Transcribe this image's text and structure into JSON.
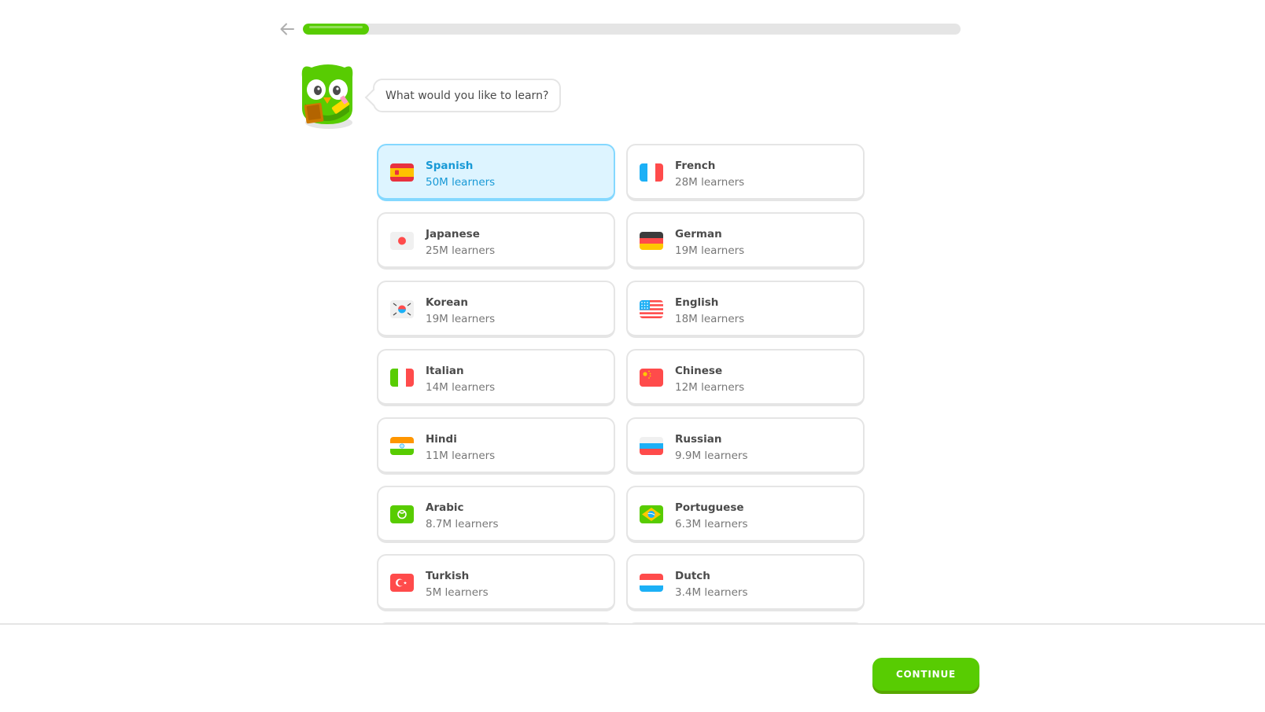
{
  "header": {
    "back_icon": "arrow-left-icon",
    "progress_fraction": 0.1
  },
  "prompt": {
    "text": "What would you like to learn?",
    "mascot_icon": "owl-mascot-icon"
  },
  "languages": [
    {
      "name": "Spanish",
      "learners": "50M learners",
      "flag": "spain-flag-icon",
      "selected": true
    },
    {
      "name": "French",
      "learners": "28M learners",
      "flag": "france-flag-icon",
      "selected": false
    },
    {
      "name": "Japanese",
      "learners": "25M learners",
      "flag": "japan-flag-icon",
      "selected": false
    },
    {
      "name": "German",
      "learners": "19M learners",
      "flag": "germany-flag-icon",
      "selected": false
    },
    {
      "name": "Korean",
      "learners": "19M learners",
      "flag": "korea-flag-icon",
      "selected": false
    },
    {
      "name": "English",
      "learners": "18M learners",
      "flag": "usa-flag-icon",
      "selected": false
    },
    {
      "name": "Italian",
      "learners": "14M learners",
      "flag": "italy-flag-icon",
      "selected": false
    },
    {
      "name": "Chinese",
      "learners": "12M learners",
      "flag": "china-flag-icon",
      "selected": false
    },
    {
      "name": "Hindi",
      "learners": "11M learners",
      "flag": "india-flag-icon",
      "selected": false
    },
    {
      "name": "Russian",
      "learners": "9.9M learners",
      "flag": "russia-flag-icon",
      "selected": false
    },
    {
      "name": "Arabic",
      "learners": "8.7M learners",
      "flag": "arabic-flag-icon",
      "selected": false
    },
    {
      "name": "Portuguese",
      "learners": "6.3M learners",
      "flag": "brazil-flag-icon",
      "selected": false
    },
    {
      "name": "Turkish",
      "learners": "5M learners",
      "flag": "turkey-flag-icon",
      "selected": false
    },
    {
      "name": "Dutch",
      "learners": "3.4M learners",
      "flag": "netherlands-flag-icon",
      "selected": false
    }
  ],
  "footer": {
    "continue_label": "CONTINUE"
  },
  "colors": {
    "accent_green": "#58cc02",
    "selected_blue": "#1899d6",
    "selected_bg": "#ddf4ff"
  }
}
